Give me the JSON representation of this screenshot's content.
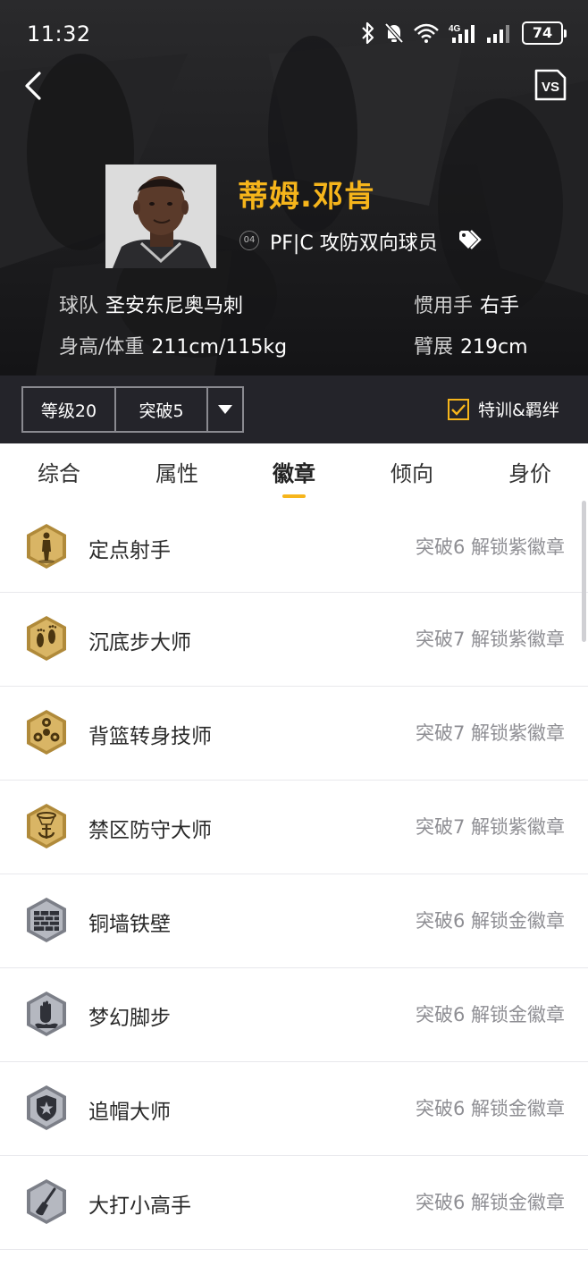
{
  "status_bar": {
    "time": "11:32",
    "battery": "74",
    "icons": [
      "bluetooth-icon",
      "bell-off-icon",
      "wifi-icon",
      "signal-4g-icon",
      "signal-icon",
      "battery-icon"
    ]
  },
  "header": {
    "back_icon": "chevron-left-icon",
    "vs_label": "VS"
  },
  "player": {
    "name": "蒂姆.邓肯",
    "jersey_number": "04",
    "position_role": "PF|C 攻防双向球员",
    "tag_icon": "tag-icon",
    "team_label": "球队",
    "team_value": "圣安东尼奥马刺",
    "hand_label": "惯用手",
    "hand_value": "右手",
    "body_label": "身高/体重",
    "body_value": "211cm/115kg",
    "wingspan_label": "臂展",
    "wingspan_value": "219cm"
  },
  "level_bar": {
    "level": "等级20",
    "breakthrough": "突破5",
    "dropdown_icon": "caret-down-icon",
    "training_label": "特训&羁绊",
    "training_checked": true
  },
  "tabs": [
    {
      "label": "综合",
      "active": false
    },
    {
      "label": "属性",
      "active": false
    },
    {
      "label": "徽章",
      "active": true
    },
    {
      "label": "倾向",
      "active": false
    },
    {
      "label": "身价",
      "active": false
    }
  ],
  "badges": [
    {
      "name": "定点射手",
      "unlock": "突破6 解锁紫徽章",
      "tier": "gold",
      "icon": "shooter-silhouette-icon"
    },
    {
      "name": "沉底步大师",
      "unlock": "突破7 解锁紫徽章",
      "tier": "gold",
      "icon": "footprints-icon"
    },
    {
      "name": "背篮转身技师",
      "unlock": "突破7 解锁紫徽章",
      "tier": "gold",
      "icon": "spinner-icon"
    },
    {
      "name": "禁区防守大师",
      "unlock": "突破7 解锁紫徽章",
      "tier": "gold",
      "icon": "hoop-anchor-icon"
    },
    {
      "name": "铜墙铁壁",
      "unlock": "突破6 解锁金徽章",
      "tier": "silver",
      "icon": "brick-wall-icon"
    },
    {
      "name": "梦幻脚步",
      "unlock": "突破6 解锁金徽章",
      "tier": "silver",
      "icon": "hand-splash-icon"
    },
    {
      "name": "追帽大师",
      "unlock": "突破6 解锁金徽章",
      "tier": "silver",
      "icon": "shield-star-icon"
    },
    {
      "name": "大打小高手",
      "unlock": "突破6 解锁金徽章",
      "tier": "silver",
      "icon": "broom-icon"
    }
  ],
  "colors": {
    "accent": "#f6b51b",
    "hero_bg": "#1b1b1d",
    "level_bar_bg": "#24242a",
    "unlock_text": "#8e8e93",
    "gold_badge": "#c9a24a",
    "silver_badge": "#9a9da6"
  }
}
